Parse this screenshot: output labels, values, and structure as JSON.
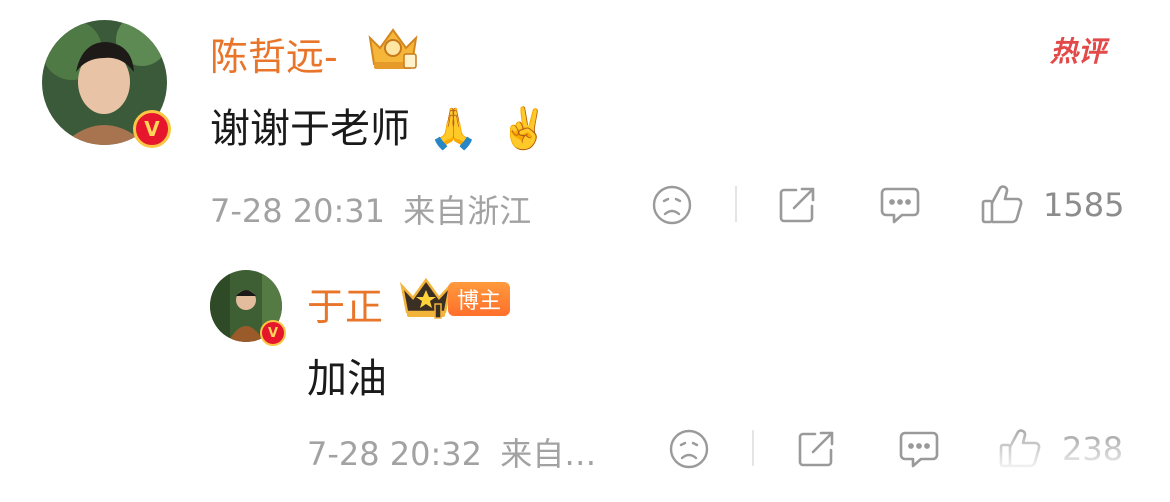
{
  "hot_tag": "热评",
  "comment": {
    "username": "陈哲远-",
    "text": "谢谢于老师",
    "emojis": [
      "🙏",
      "✌️"
    ],
    "time": "7-28 20:31",
    "location": "来自浙江",
    "likes": "1585",
    "verified_badge": "V",
    "crown_icon": "crown-badge-icon"
  },
  "reply": {
    "username": "于正",
    "blogger_label": "博主",
    "text": "加油",
    "time": "7-28 20:32",
    "location": "来自…",
    "likes": "238",
    "verified_badge": "V",
    "crown_icon": "crown-badge-icon"
  },
  "colors": {
    "username": "#e8752a",
    "meta": "#a2a2a2",
    "hot": "#e24a4a",
    "badge_red": "#e6162d"
  }
}
